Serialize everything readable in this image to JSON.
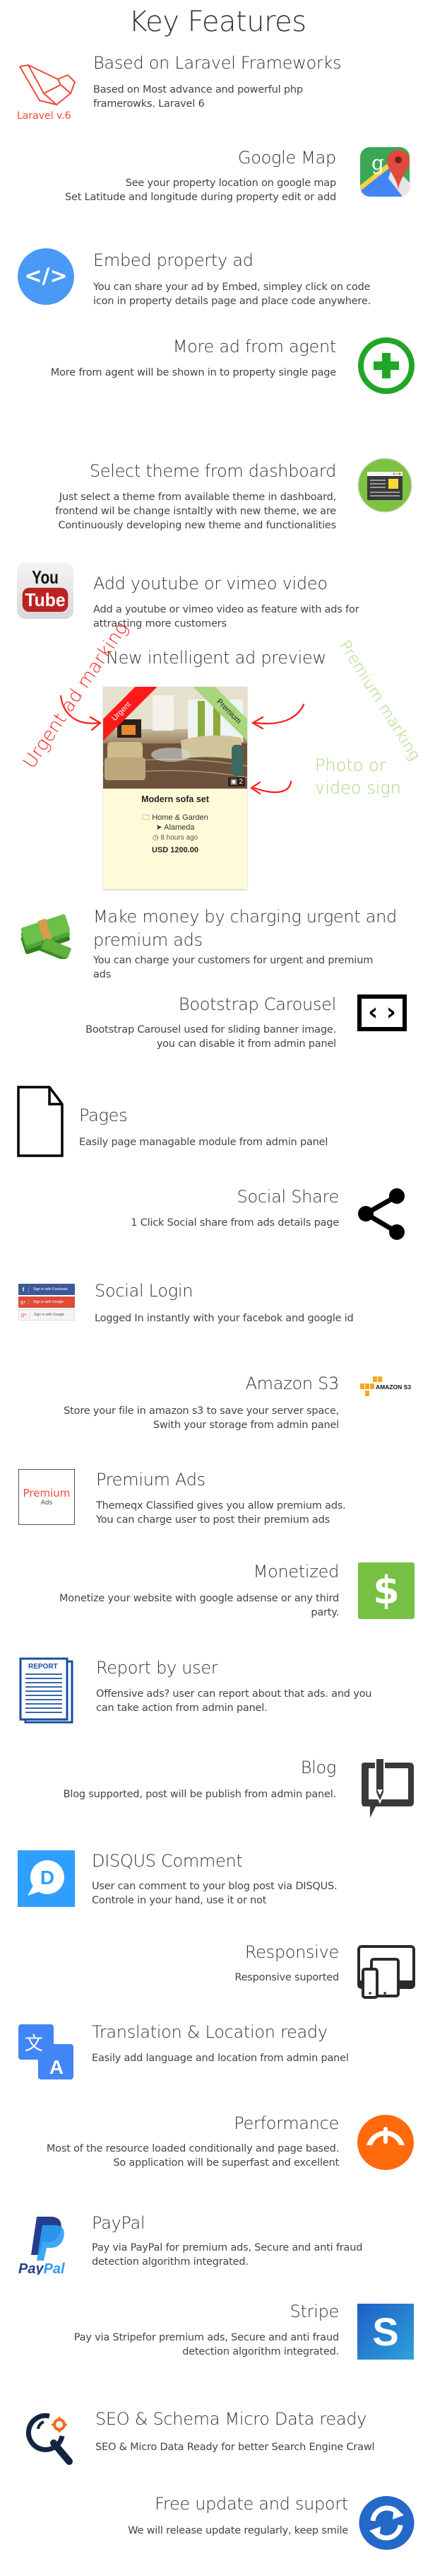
{
  "page": {
    "title": "Key Features"
  },
  "features": {
    "laravel": {
      "title": "Based on Laravel Frameworks",
      "desc_lines": [
        "Based on Most advance and powerful php",
        "framerowks. Laravel 6"
      ],
      "icon_label": "Laravel v.6",
      "icon": "laravel-logo-icon",
      "color": "#f4493a"
    },
    "google_map": {
      "title": "Google Map",
      "desc_lines": [
        "See your property location on google map",
        "Set Latitude and longitude  during property edit or add"
      ],
      "icon": "google-maps-icon"
    },
    "embed": {
      "title": "Embed property ad",
      "desc_lines": [
        "You can share your ad by Embed, simpley click on code",
        "icon in property details page and place code anywhere."
      ],
      "icon": "code-embed-icon",
      "icon_glyph": "</>",
      "color": "#4a9af5"
    },
    "more_ad": {
      "title": "More ad from agent",
      "desc_lines": [
        "More from agent will be shown in to property single page"
      ],
      "icon": "plus-circle-icon",
      "color": "#21a623"
    },
    "theme": {
      "title": "Select theme from dashboard",
      "desc_lines": [
        "Just select a theme from available theme in dashboard,",
        "frontend wil be change isntaltly with new theme, we are",
        "Continuously developing new theme and functionalities"
      ],
      "icon": "browser-theme-icon",
      "color": "#7dc242"
    },
    "video": {
      "title": "Add youtube or vimeo video",
      "desc_lines": [
        "Add a youtube or vimeo video as feature with ads for",
        "attracting more customers"
      ],
      "icon": "youtube-icon",
      "icon_top": "You",
      "icon_bottom": "Tube"
    },
    "ad_preview": {
      "title": "New intelligent ad preview",
      "annotations": {
        "urgent": "Urgent ad marking",
        "premium": "Premium marking",
        "photo": [
          "Photo or",
          "video sign"
        ]
      },
      "colors": {
        "urgent": "#ff1a1a",
        "premium": "#a8d67e"
      },
      "card": {
        "urgent_badge": "Urgent",
        "premium_badge": "Premium",
        "photo_count": "2",
        "title": "Modern sofa set",
        "category": "Home & Garden",
        "location": "Alameda",
        "time": "8 hours ago",
        "price": "USD 1200.00"
      }
    },
    "money": {
      "title_lines": [
        "Make money by charging urgent and",
        "premium ads"
      ],
      "desc_lines": [
        "You can charge your customers for urgent and premium",
        "ads"
      ],
      "icon": "money-stack-icon"
    },
    "carousel": {
      "title": "Bootstrap Carousel",
      "desc_lines": [
        "Bootstrap Carousel used for sliding banner image.",
        "you can disable it from admin panel"
      ],
      "icon": "carousel-arrows-icon",
      "icon_glyph": "‹ ›"
    },
    "pages": {
      "title": "Pages",
      "desc_lines": [
        "Easily page managable module from admin panel"
      ],
      "icon": "document-page-icon"
    },
    "social_share": {
      "title": "Social Share",
      "desc_lines": [
        "1 Click Social share from ads details page"
      ],
      "icon": "share-icon"
    },
    "social_login": {
      "title": "Social Login",
      "desc_lines": [
        "Logged In instantly with your facebok and google id"
      ],
      "icon": "social-login-buttons-icon",
      "buttons": [
        {
          "glyph": "f",
          "label": "Sign in with Facebook",
          "bg": "#3b5998"
        },
        {
          "glyph": "g+",
          "label": "Sign in with Google",
          "bg": "#dd4b39"
        },
        {
          "glyph": "g+",
          "label": "Sign in with Google",
          "bg": "#f5f5f5"
        }
      ]
    },
    "s3": {
      "title": "Amazon S3",
      "desc_lines": [
        "Store your file in amazon s3 to save your server space,",
        "Swith your storage from admin panel"
      ],
      "icon": "amazon-s3-icon",
      "icon_label": "AMAZON S3"
    },
    "premium_ads": {
      "title": "Premium Ads",
      "desc_lines": [
        "Themeqx Classified gives you allow premium ads.",
        "You can charge user to post their premium ads"
      ],
      "icon": "premium-ads-icon",
      "icon_top": "Premium",
      "icon_bottom": "Ads"
    },
    "monetized": {
      "title": "Monetized",
      "desc_lines": [
        "Monetize your website with google adsense or any third",
        "party."
      ],
      "icon": "dollar-icon",
      "icon_glyph": "$",
      "color": "#76c043"
    },
    "report": {
      "title": "Report by user",
      "desc_lines": [
        "Offensive ads? user can report about that ads. and you",
        "can take action from admin panel."
      ],
      "icon": "report-document-icon",
      "icon_label": "REPORT"
    },
    "blog": {
      "title": "Blog",
      "desc_lines": [
        "Blog supported, post will be publish from admin panel."
      ],
      "icon": "blog-pen-icon"
    },
    "disqus": {
      "title": "DISQUS Comment",
      "desc_lines": [
        "User can comment to your blog post via DISQUS.",
        "Controle in your hand, use it or not"
      ],
      "icon": "disqus-icon",
      "icon_glyph": "D",
      "color": "#2e9fff"
    },
    "responsive": {
      "title": "Responsive",
      "desc_lines": [
        "Responsive suported"
      ],
      "icon": "responsive-devices-icon"
    },
    "translation": {
      "title": "Translation & Location ready",
      "desc_lines": [
        "Easily add language and location from admin panel"
      ],
      "icon": "translate-icon",
      "icon_glyph_a": "文",
      "icon_glyph_b": "A",
      "color": "#4285f4"
    },
    "performance": {
      "title": "Performance",
      "desc_lines": [
        "Most of the resource loaded conditionally and page based.",
        "So application will be superfast and excellent"
      ],
      "icon": "speedometer-icon",
      "color": "#ff6a0c"
    },
    "paypal": {
      "title": "PayPal",
      "desc_lines": [
        "Pay via PayPal for premium ads, Secure and anti fraud",
        "detection algorithm integrated."
      ],
      "icon": "paypal-icon",
      "icon_label_a": "Pay",
      "icon_label_b": "Pal"
    },
    "stripe": {
      "title": "Stripe",
      "desc_lines": [
        "Pay via Stripefor premium ads, Secure and anti fraud",
        "detection algorithm integrated."
      ],
      "icon": "stripe-icon",
      "icon_glyph": "S"
    },
    "seo": {
      "title": "SEO & Schema Micro Data ready",
      "desc_lines": [
        "SEO & Micro Data Ready for better Search Engine Crawl"
      ],
      "icon": "seo-search-gear-icon"
    },
    "updates": {
      "title": "Free update and suport",
      "desc_lines": [
        "We will release update regularly, keep smile"
      ],
      "icon": "refresh-update-icon",
      "color": "#2468c8"
    }
  }
}
